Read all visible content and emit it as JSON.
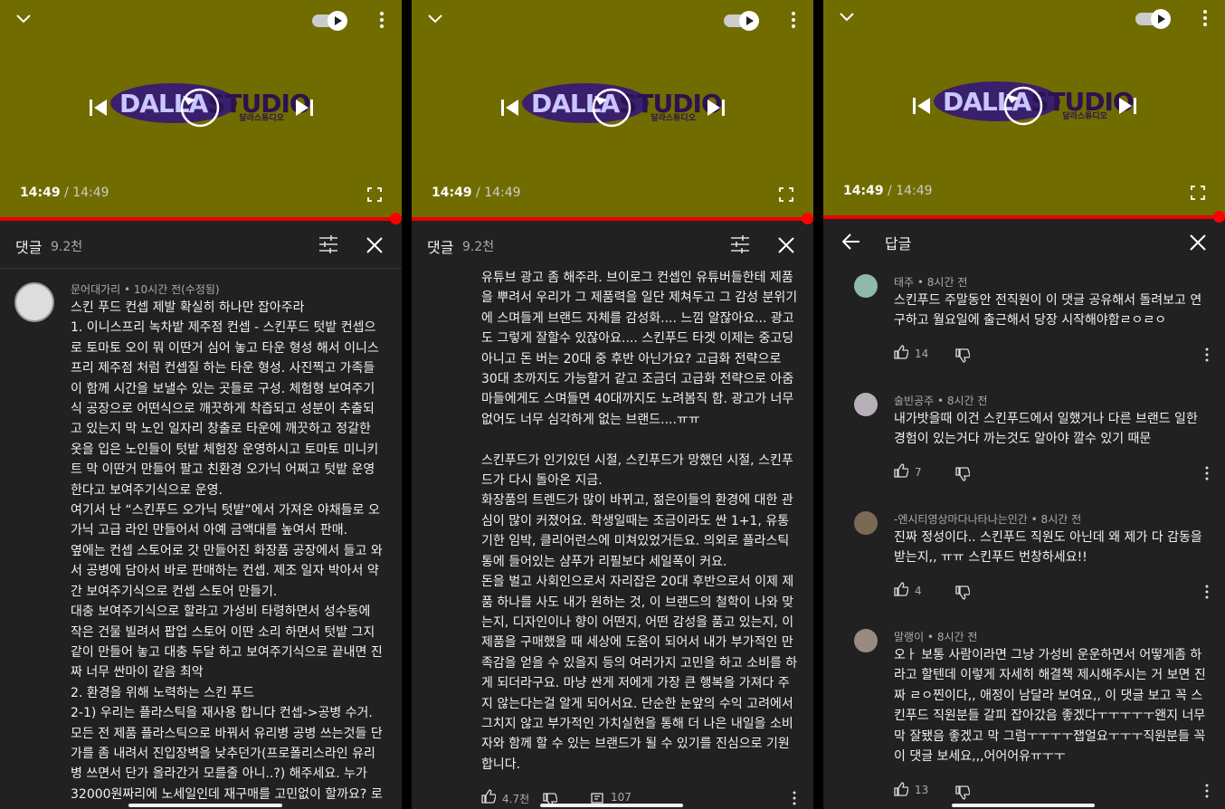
{
  "player": {
    "time_current": "14:49",
    "time_total": " / 14:49",
    "logo_text_a": "DALLA",
    "logo_text_b": "STUDIO",
    "logo_sub": "달라스튜디오"
  },
  "panel1": {
    "header_title": "댓글",
    "header_count": "9.2천",
    "comment_author": "문어대가리 • 10시간 전(수정됨)",
    "comment_text": "스킨 푸드 컨셉 제발 확실히 하나만 잡아주라\n1. 이니스프리 녹차밭 제주점 컨셉 - 스킨푸드 텃밭 컨셉으로 토마토 오이 뭐 이딴거 심어 놓고 타운 형성 해서 이니스프리 제주점 처럼 컨셉질 하는 타운 형성. 사진찍고 가족들이 함께 시간을 보낼수 있는 곳들로 구성. 체험형 보여주기식 공장으로 어떤식으로 깨끗하게 착즙되고 성분이 추출되고 있는지 막 노인 일자리 창출로 타운에 깨끗하고 정갈한 옷을 입은 노인들이 텃밭 체험장 운영하시고 토마토 미니키트 막 이딴거 만들어 팔고 친환경 오가닉 어쩌고 텃밭 운영한다고 보여주기식으로 운영.\n여기서 난 “스킨푸드 오가닉 텃밭”에서 가져온 야채들로 오가닉 고급 라인 만들어서 아예 금액대를 높여서 판매.\n옆에는 컨셉 스토어로 갓 만들어진 화장품 공장에서 들고 와서 공병에 담아서 바로 판매하는 컨셉. 제조 일자 박아서 약간 보여주기식으로 컨셉 스토어 만들기.\n대충 보여주기식으로 할라고 가성비 타령하면서 성수동에 작은 건물 빌려서 팝업 스토어 이딴 소리 하면서 텃밭 그지같이 만들어 놓고 대충 두달 하고 보여주기식으로 끝내면 진짜 너무 싼마이 같음 최악\n2. 환경을 위해 노력하는 스킨 푸드\n2-1) 우리는 플라스틱을 재사용 합니다 컨셉->공병 수거. 모든 전 제품 플라스틱으로 바꿔서 유리병 공병 쓰는것들 단가를 좀 내려서 진입장벽을 낮추던가(프로폴리스라인 유리병 쓰면서 단가 올라간거 모를줄 아니..?) 해주세요. 누가 32000원짜리에 노세일인데 재구매를 고민없이 할까요? 로"
  },
  "panel2": {
    "header_title": "댓글",
    "header_count": "9.2천",
    "comment_text": "유튜브 광고 좀 해주라. 브이로그 컨셉인 유튜버들한테 제품을 뿌려서 우리가 그 제품력을 일단 제쳐두고 그 감성 분위기에 스며들게 브랜드 자체를 감성화.... 느낌 알잖아요... 광고도 그렇게 잘할수 있잖아요.... 스킨푸드 타겟 이제는 중고딩 아니고 돈 버는 20대 중 후반 아닌가요? 고급화 전략으로 30대 초까지도 가능할거 같고 조금더 고급화 전략으로 아줌마들에게도 스며들면 40대까지도 노려봄직 함. 광고가 너무 없어도 너무 심각하게 없는 브랜드....ㅠㅠ\n\n스킨푸드가 인기있던 시절, 스킨푸드가 망했던 시절, 스킨푸드가 다시 돌아온 지금.\n화장품의 트렌드가 많이 바뀌고, 젊은이들의 환경에 대한 관심이 많이 커졌어요. 학생일때는 조금이라도 싼 1+1, 유통기한 임박, 클리어런스에 미쳐있었거든요. 의외로 플라스틱 통에 들어있는 샴푸가 리필보다 세일폭이 커요.\n돈을 벌고 사회인으로서 자리잡은 20대 후반으로서 이제 제품 하나를 사도 내가 원하는 것, 이 브랜드의 철학이 나와 맞는지, 디자인이나 향이 어떤지, 어떤 감성을 품고 있는지, 이 제품을 구매했을 때 세상에 도움이 되어서 내가 부가적인 만족감을 얻을 수 있을지 등의 여러가지 고민을 하고 소비를 하게 되더라구요. 마냥 싼게 저에게 가장 큰 행복을 가져다 주지 않는다는걸 알게 되어서요. 단순한 눈앞의 수익 고려에서 그치지 않고 부가적인 가치실현을 통해 더 나은 내일을 소비자와 함께 할 수 있는 브랜드가 될 수 있기를 진심으로 기원합니다.",
    "likes": "4.7천",
    "replies": "107"
  },
  "panel3": {
    "header_title": "답글",
    "replies": [
      {
        "author": "태주 • 8시간 전",
        "text": "스킨푸드 주말동안 전직원이 이 댓글 공유해서 돌려보고 연구하고 월요일에 출근해서 당장 시작해야함ㄹㅇㄹㅇ",
        "likes": "14",
        "avatar_color": "#8fb9a8"
      },
      {
        "author": "술빈공주 • 8시간 전",
        "text": "내가밧을때 이건 스킨푸드에서 일했거나 다른 브랜드 일한 경험이 있는거다 까는것도 알아야 깔수 있기 때문",
        "likes": "7",
        "avatar_color": "#b8b0b8"
      },
      {
        "author": "-엔시티영상마다나타나는인간 • 8시간 전",
        "text": "진짜 정성이다.. 스킨푸드 직원도 아닌데 왜 제가 다 감동을 받는지,, ㅠㅠ 스킨푸드 번창하세요!!",
        "likes": "4",
        "avatar_color": "#7a6a55"
      },
      {
        "author": "말랭이 • 8시간 전",
        "text": "오ㅏ 보통 사람이라면 그냥 가성비 운운하면서 어떻게좀 하라고 할텐데 이렇게 자세히 해결책 제시해주시는 거 보면 진짜 ㄹㅇ찐이다,, 애정이 남달라 보여요,, 이 댓글 보고 꼭 스킨푸드 직원분들 갈피 잡아갔음 좋겠다ㅜㅜㅜㅜㅜ왠지 너무 막 잘됐음 좋겠고 막 그럼ㅜㅜㅜㅜ잽얼요ㅜㅜㅜ직원분들 꼭 이 댓글 보세요,,,어어어유ㅠㅜㅜ",
        "likes": "13",
        "avatar_color": "#9a8a80"
      }
    ]
  },
  "colors": {
    "video_bg": "#716c00",
    "panel_bg": "#212121",
    "progress": "#ff0000"
  }
}
